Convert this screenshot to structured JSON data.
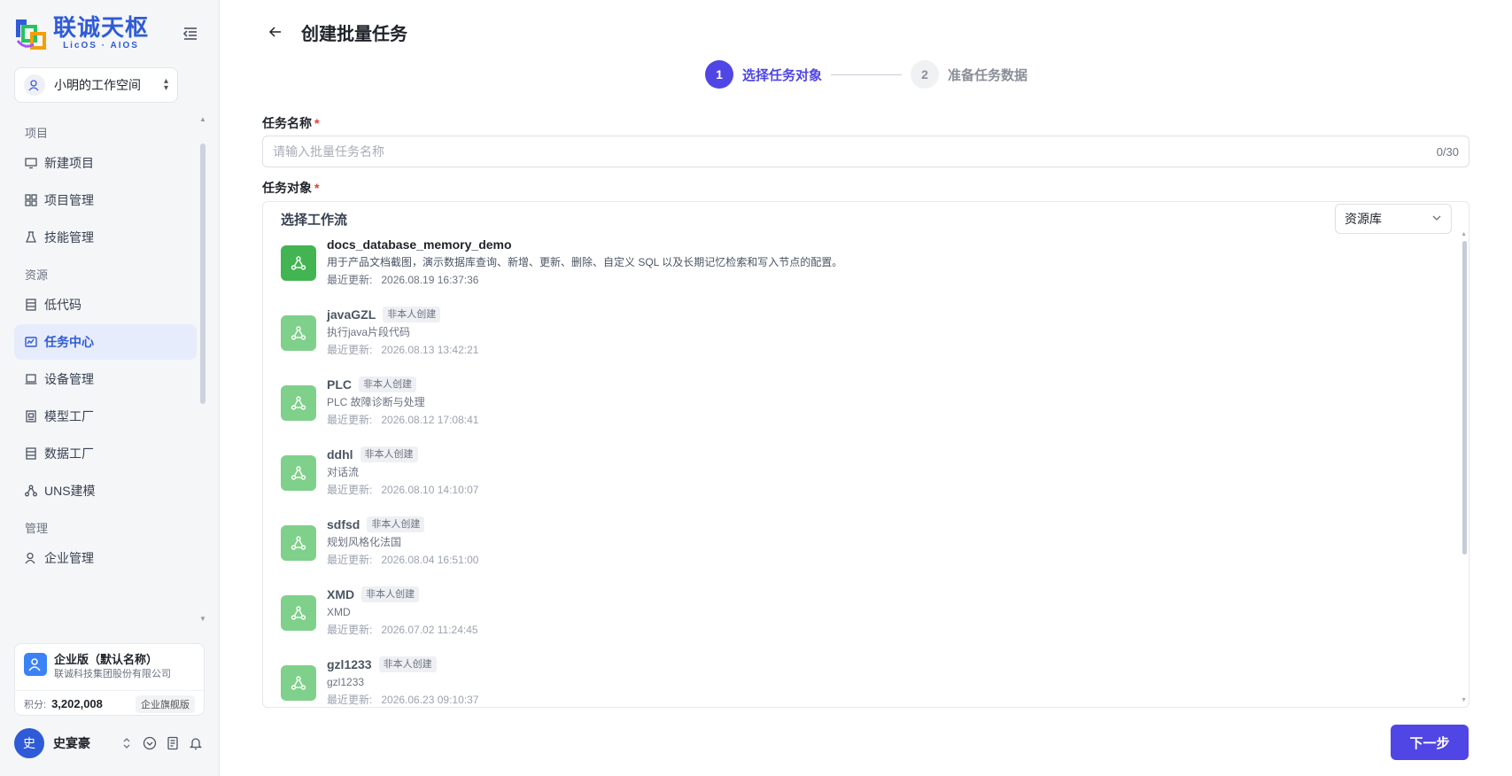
{
  "brand": {
    "name_cn": "联诚天枢",
    "name_en": "LicOS · AIOS"
  },
  "workspace": {
    "name": "小明的工作空间"
  },
  "sidebar": {
    "groups": [
      {
        "label": "项目",
        "items": [
          {
            "label": "新建项目",
            "icon": "monitor-icon"
          },
          {
            "label": "项目管理",
            "icon": "grid-icon"
          },
          {
            "label": "技能管理",
            "icon": "flask-icon"
          }
        ]
      },
      {
        "label": "资源",
        "items": [
          {
            "label": "低代码",
            "icon": "database-icon"
          },
          {
            "label": "任务中心",
            "icon": "task-icon",
            "active": true
          },
          {
            "label": "设备管理",
            "icon": "laptop-icon"
          },
          {
            "label": "模型工厂",
            "icon": "model-icon"
          },
          {
            "label": "数据工厂",
            "icon": "database-icon"
          },
          {
            "label": "UNS建模",
            "icon": "network-icon"
          }
        ]
      },
      {
        "label": "管理",
        "items": [
          {
            "label": "企业管理",
            "icon": "users-icon"
          }
        ]
      }
    ]
  },
  "enterprise": {
    "name": "企业版（默认名称）",
    "org": "联诚科技集团股份有限公司",
    "points_label": "积分:",
    "points": "3,202,008",
    "plan": "企业旗舰版"
  },
  "user": {
    "avatar_char": "史",
    "name": "史宴豪"
  },
  "page": {
    "title": "创建批量任务"
  },
  "steps": [
    {
      "num": "1",
      "label": "选择任务对象",
      "active": true
    },
    {
      "num": "2",
      "label": "准备任务数据",
      "active": false
    }
  ],
  "form": {
    "name_label": "任务名称",
    "name_placeholder": "请输入批量任务名称",
    "name_value": "",
    "name_counter": "0/30",
    "target_label": "任务对象",
    "workflow_title": "选择工作流",
    "source_select": "资源库"
  },
  "workflows": [
    {
      "name": "docs_database_memory_demo",
      "badge": "",
      "desc": "用于产品文档截图，演示数据库查询、新增、更新、删除、自定义 SQL 以及长期记忆检索和写入节点的配置。",
      "time_label": "最近更新:",
      "time": "2026.08.19 16:37:36",
      "mine": true
    },
    {
      "name": "javaGZL",
      "badge": "非本人创建",
      "desc": "执行java片段代码",
      "time_label": "最近更新:",
      "time": "2026.08.13 13:42:21",
      "mine": false
    },
    {
      "name": "PLC",
      "badge": "非本人创建",
      "desc": "PLC 故障诊断与处理",
      "time_label": "最近更新:",
      "time": "2026.08.12 17:08:41",
      "mine": false
    },
    {
      "name": "ddhl",
      "badge": "非本人创建",
      "desc": "对话流",
      "time_label": "最近更新:",
      "time": "2026.08.10 14:10:07",
      "mine": false
    },
    {
      "name": "sdfsd",
      "badge": "非本人创建",
      "desc": "规划风格化法国",
      "time_label": "最近更新:",
      "time": "2026.08.04 16:51:00",
      "mine": false
    },
    {
      "name": "XMD",
      "badge": "非本人创建",
      "desc": "XMD",
      "time_label": "最近更新:",
      "time": "2026.07.02 11:24:45",
      "mine": false
    },
    {
      "name": "gzl1233",
      "badge": "非本人创建",
      "desc": "gzl1233",
      "time_label": "最近更新:",
      "time": "2026.06.23 09:10:37",
      "mine": false
    }
  ],
  "actions": {
    "next": "下一步"
  },
  "colors": {
    "primary": "#4f46e5",
    "brand_blue": "#2f5bd8",
    "workflow_green": "#43b452",
    "workflow_green_light": "#7fd08a",
    "required": "#e53935"
  }
}
